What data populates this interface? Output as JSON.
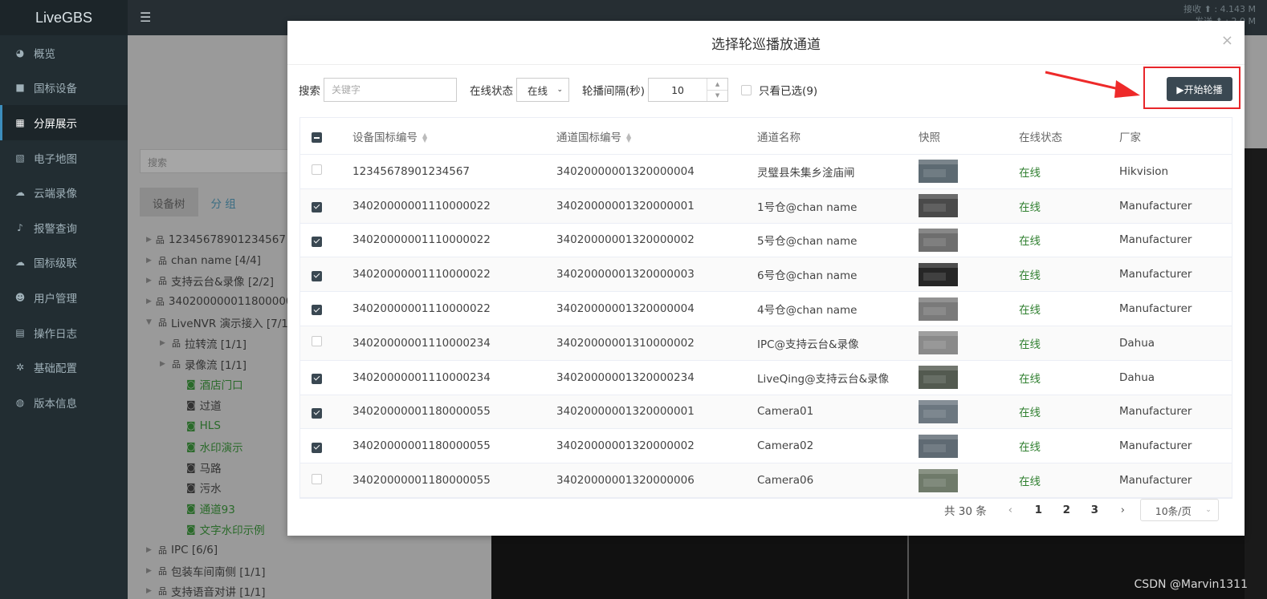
{
  "app": {
    "logo": "LiveGBS",
    "net_stats": [
      "接收 ⬆ : 4.143 M",
      "发送 ⬆ : 2.0 M"
    ]
  },
  "sidebar": {
    "items": [
      {
        "label": "概览",
        "icon": "dashboard-icon",
        "glyph": "◕"
      },
      {
        "label": "国标设备",
        "icon": "video-camera-icon",
        "glyph": "■"
      },
      {
        "label": "分屏展示",
        "icon": "grid-icon",
        "glyph": "▦",
        "active": true
      },
      {
        "label": "电子地图",
        "icon": "map-icon",
        "glyph": "▧"
      },
      {
        "label": "云端录像",
        "icon": "cloud-icon",
        "glyph": "☁"
      },
      {
        "label": "报警查询",
        "icon": "bell-icon",
        "glyph": "♪"
      },
      {
        "label": "国标级联",
        "icon": "cloud-upload-icon",
        "glyph": "☁"
      },
      {
        "label": "用户管理",
        "icon": "users-icon",
        "glyph": "☻"
      },
      {
        "label": "操作日志",
        "icon": "file-icon",
        "glyph": "▤"
      },
      {
        "label": "基础配置",
        "icon": "gears-icon",
        "glyph": "✲"
      },
      {
        "label": "版本信息",
        "icon": "globe-icon",
        "glyph": "◍"
      }
    ]
  },
  "bg": {
    "search_placeholder": "搜索",
    "tabs": [
      "设备树",
      "分 组"
    ],
    "tree": [
      {
        "label": "12345678901234567 [1/1]",
        "type": "group",
        "indent": 0
      },
      {
        "label": "chan name [4/4]",
        "type": "group",
        "indent": 0
      },
      {
        "label": "支持云台&录像 [2/2]",
        "type": "group",
        "indent": 0
      },
      {
        "label": "34020000001180000055",
        "type": "group",
        "indent": 0
      },
      {
        "label": "LiveNVR 演示接入 [7/1]",
        "type": "group",
        "indent": 0,
        "open": true
      },
      {
        "label": "拉转流 [1/1]",
        "type": "group",
        "indent": 1
      },
      {
        "label": "录像流 [1/1]",
        "type": "group",
        "indent": 1
      },
      {
        "label": "酒店门口",
        "type": "channel",
        "indent": 2,
        "online": true
      },
      {
        "label": "过道",
        "type": "channel",
        "indent": 2,
        "online": false
      },
      {
        "label": "HLS",
        "type": "channel",
        "indent": 2,
        "online": true
      },
      {
        "label": "水印演示",
        "type": "channel",
        "indent": 2,
        "online": true
      },
      {
        "label": "马路",
        "type": "channel",
        "indent": 2,
        "online": false
      },
      {
        "label": "污水",
        "type": "channel",
        "indent": 2,
        "online": false
      },
      {
        "label": "通道93",
        "type": "channel",
        "indent": 2,
        "online": true
      },
      {
        "label": "文字水印示例",
        "type": "channel",
        "indent": 2,
        "online": true
      },
      {
        "label": "IPC [6/6]",
        "type": "group",
        "indent": 0
      },
      {
        "label": "包装车间南侧 [1/1]",
        "type": "group",
        "indent": 0
      },
      {
        "label": "支持语音对讲 [1/1]",
        "type": "group",
        "indent": 0
      }
    ]
  },
  "modal": {
    "title": "选择轮巡播放通道",
    "close": "×",
    "search_label": "搜索",
    "search_placeholder": "关键字",
    "status_label": "在线状态",
    "status_value": "在线",
    "interval_label": "轮播间隔(秒)",
    "interval_value": "10",
    "only_selected_label": "只看已选(9)",
    "start_button": "▶开始轮播",
    "columns": [
      "设备国标编号",
      "通道国标编号",
      "通道名称",
      "快照",
      "在线状态",
      "厂家"
    ],
    "rows": [
      {
        "checked": false,
        "device": "12345678901234567",
        "channel": "34020000001320000004",
        "name": "灵璧县朱集乡淦庙闸",
        "status": "在线",
        "vendor": "Hikvision",
        "thumb": "#5d6a72"
      },
      {
        "checked": true,
        "device": "34020000001110000022",
        "channel": "34020000001320000001",
        "name": "1号仓@chan name",
        "status": "在线",
        "vendor": "Manufacturer",
        "thumb": "#4a4a4a"
      },
      {
        "checked": true,
        "device": "34020000001110000022",
        "channel": "34020000001320000002",
        "name": "5号仓@chan name",
        "status": "在线",
        "vendor": "Manufacturer",
        "thumb": "#6e6e6e"
      },
      {
        "checked": true,
        "device": "34020000001110000022",
        "channel": "34020000001320000003",
        "name": "6号仓@chan name",
        "status": "在线",
        "vendor": "Manufacturer",
        "thumb": "#262626"
      },
      {
        "checked": true,
        "device": "34020000001110000022",
        "channel": "34020000001320000004",
        "name": "4号仓@chan name",
        "status": "在线",
        "vendor": "Manufacturer",
        "thumb": "#7a7a7a"
      },
      {
        "checked": false,
        "device": "34020000001110000234",
        "channel": "34020000001310000002",
        "name": "IPC@支持云台&录像",
        "status": "在线",
        "vendor": "Dahua",
        "thumb": "#8a8a8a"
      },
      {
        "checked": true,
        "device": "34020000001110000234",
        "channel": "34020000001320000234",
        "name": "LiveQing@支持云台&录像",
        "status": "在线",
        "vendor": "Dahua",
        "thumb": "#535a50"
      },
      {
        "checked": true,
        "device": "34020000001180000055",
        "channel": "34020000001320000001",
        "name": "Camera01",
        "status": "在线",
        "vendor": "Manufacturer",
        "thumb": "#6c7780"
      },
      {
        "checked": true,
        "device": "34020000001180000055",
        "channel": "34020000001320000002",
        "name": "Camera02",
        "status": "在线",
        "vendor": "Manufacturer",
        "thumb": "#5f6a73"
      },
      {
        "checked": false,
        "device": "34020000001180000055",
        "channel": "34020000001320000006",
        "name": "Camera06",
        "status": "在线",
        "vendor": "Manufacturer",
        "thumb": "#6f7a6a"
      }
    ],
    "pager": {
      "total": "共 30 条",
      "pages": [
        "1",
        "2",
        "3"
      ],
      "page_size": "10条/页"
    }
  },
  "watermark": "CSDN @Marvin1311",
  "colors": {
    "accent": "#3a4852",
    "highlight": "#e8262a",
    "online": "#2f7f2f"
  }
}
